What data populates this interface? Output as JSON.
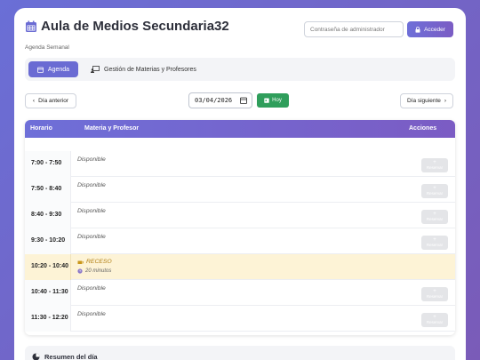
{
  "header": {
    "title": "Aula de Medios Secundaria32",
    "subtitle": "Agenda Semanal",
    "password_placeholder": "Contraseña de administrador",
    "login_label": "Acceder",
    "title_icon": "calendar-icon",
    "accent": "#6e6fd8"
  },
  "tabs": [
    {
      "label": "Agenda",
      "icon": "calendar-icon",
      "active": true
    },
    {
      "label": "Gestión de Materias y Profesores",
      "icon": "chalkboard-user-icon",
      "active": false
    }
  ],
  "nav": {
    "prev_label": "Día anterior",
    "next_label": "Día siguiente",
    "date_value": "03/04/2026",
    "today_label": "Hoy"
  },
  "table": {
    "col_horario": "Horario",
    "col_materia": "Materia y Profesor",
    "col_acciones": "Acciones",
    "rows": [
      {
        "time": "7:00 - 7:50",
        "status": "Disponible",
        "action": "Reservar"
      },
      {
        "time": "7:50 - 8:40",
        "status": "Disponible",
        "action": "Reservar"
      },
      {
        "time": "8:40 - 9:30",
        "status": "Disponible",
        "action": "Reservar"
      },
      {
        "time": "9:30 - 10:20",
        "status": "Disponible",
        "action": "Reservar"
      },
      {
        "time": "10:20 - 10:40",
        "status": "RECESO",
        "duration": "20 minutos"
      },
      {
        "time": "10:40 - 11:30",
        "status": "Disponible",
        "action": "Reservar"
      },
      {
        "time": "11:30 - 12:20",
        "status": "Disponible",
        "action": "Reservar"
      }
    ]
  },
  "summary": {
    "title": "Resumen del día"
  },
  "colors": {
    "today_button": "#2f9e5b",
    "recess_bg": "#fdf3d6",
    "recess_accent": "#f0b429"
  }
}
